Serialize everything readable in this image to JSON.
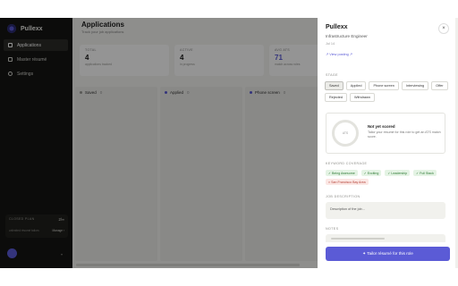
{
  "app": {
    "name": "Pullexx"
  },
  "sidebar": {
    "items": [
      {
        "label": "Applications",
        "icon": "grid-icon",
        "active": true
      },
      {
        "label": "Master résumé",
        "icon": "document-icon",
        "active": false
      },
      {
        "label": "Settings",
        "icon": "gear-icon",
        "active": false
      }
    ],
    "plan": {
      "name": "CLOSED PLAN",
      "count": "2/∞",
      "sub": "unlimited résumé tailors",
      "manage": "Manage ›"
    }
  },
  "main": {
    "title": "Applications",
    "subtitle": "Track your job applications",
    "stats": [
      {
        "label": "TOTAL",
        "value": "4",
        "note": "applications tracked"
      },
      {
        "label": "ACTIVE",
        "value": "4",
        "note": "in progress"
      },
      {
        "label": "AVG ATS",
        "value": "71",
        "note": "match across roles"
      }
    ],
    "columns": [
      {
        "label": "Saved",
        "count": "0",
        "color": "#9a9a94"
      },
      {
        "label": "Applied",
        "count": "0",
        "color": "#5b5bd6"
      },
      {
        "label": "Phone screen",
        "count": "0",
        "color": "#5b5bd6"
      }
    ]
  },
  "drawer": {
    "title": "Pullexx",
    "role": "Infrastructure Engineer",
    "date": "Jul 14",
    "view_posting": "↗ View posting ↗",
    "close_glyph": "×",
    "stage_label": "STAGE",
    "stages": [
      "Saved",
      "Applied",
      "Phone screen",
      "Interviewing",
      "Offer",
      "Rejected",
      "Withdrawn"
    ],
    "selected_stage": "Saved",
    "score": {
      "ring_text": "ATS",
      "title": "Not yet scored",
      "desc": "Tailor your résumé for this role to get an ATS match score."
    },
    "keyword_label": "KEYWORD COVERAGE",
    "keywords": [
      {
        "text": "✓ Being Awesome",
        "status": "match"
      },
      {
        "text": "✓ Exciting",
        "status": "match"
      },
      {
        "text": "✓ Leadership",
        "status": "match"
      },
      {
        "text": "✓ Full Stack",
        "status": "match"
      },
      {
        "text": "× San Francisco Bay Area",
        "status": "miss"
      }
    ],
    "desc_label": "JOB DESCRIPTION",
    "desc_placeholder": "Description of the job...",
    "notes_label": "NOTES",
    "cta": "✦ Tailor résumé for this role",
    "accent": "#5b5bd6"
  }
}
